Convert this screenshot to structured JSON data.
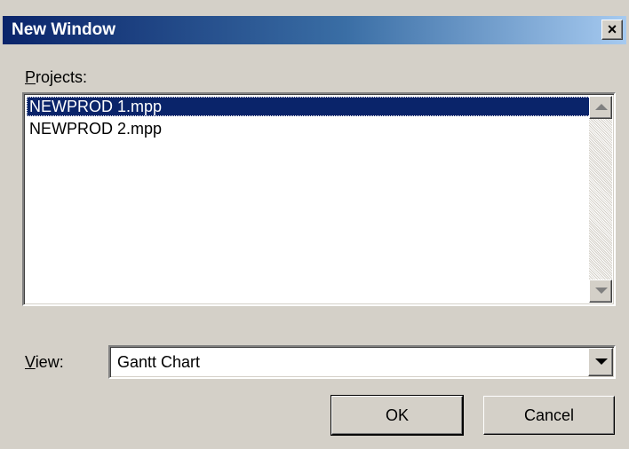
{
  "dialog": {
    "title": "New Window",
    "close_glyph": "×"
  },
  "projects": {
    "label_accel": "P",
    "label_rest": "rojects:",
    "items": [
      {
        "label": "NEWPROD 1.mpp",
        "selected": true
      },
      {
        "label": "NEWPROD 2.mpp",
        "selected": false
      }
    ]
  },
  "view": {
    "label_accel": "V",
    "label_rest": "iew:",
    "value": "Gantt Chart"
  },
  "buttons": {
    "ok": "OK",
    "cancel": "Cancel"
  },
  "colors": {
    "dialog_bg": "#d4d0c8",
    "titlebar_start": "#0a246a",
    "titlebar_end": "#a6caf0",
    "selection": "#0a246a"
  },
  "icons": {
    "close": "close-icon",
    "scroll_up": "arrow-up-icon",
    "scroll_down": "arrow-down-icon",
    "dropdown": "chevron-down-icon"
  }
}
